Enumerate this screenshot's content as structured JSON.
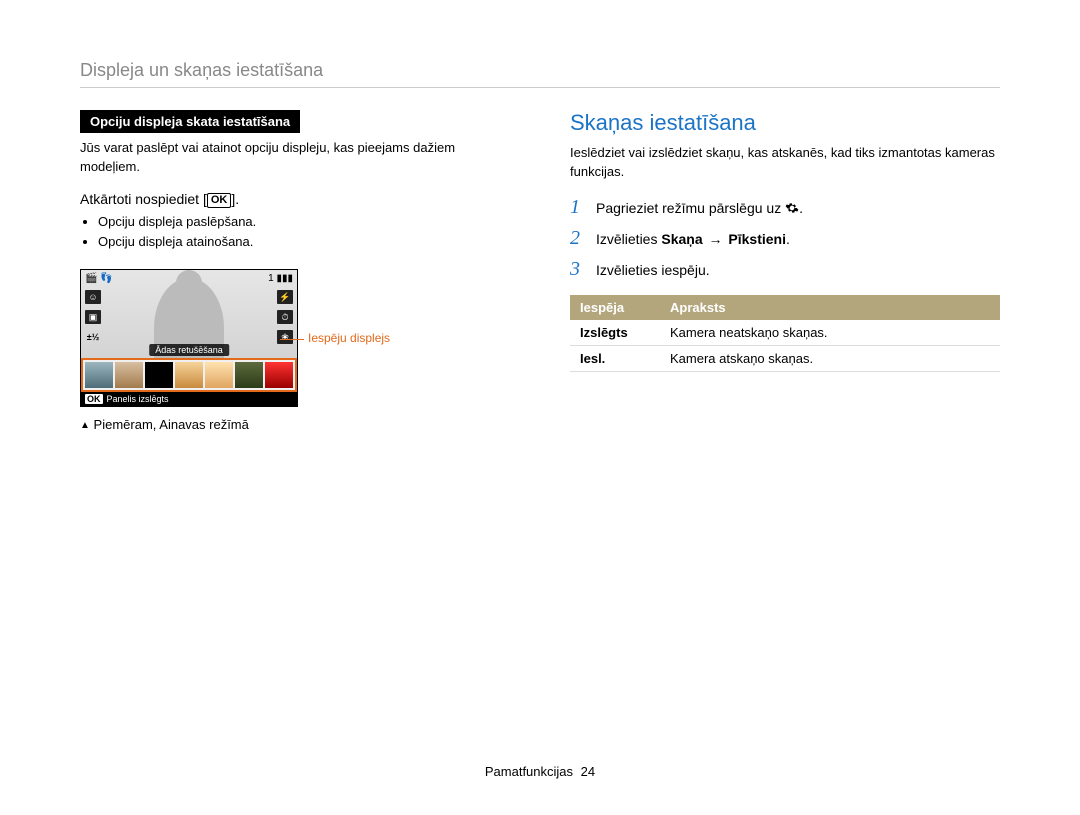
{
  "page_title": "Displeja un skaņas iestatīšana",
  "left": {
    "box_heading": "Opciju displeja skata iestatīšana",
    "intro": "Jūs varat paslēpt vai atainot opciju displeju, kas pieejams dažiem modeļiem.",
    "sub_instruction_prefix": "Atkārtoti nospiediet [",
    "sub_instruction_suffix": "].",
    "ok_label": "OK",
    "bullets": [
      "Opciju displeja paslēpšana.",
      "Opciju displeja atainošana."
    ],
    "camera": {
      "top_bar_left": "🎬 👣",
      "top_bar_right_counter": "1",
      "skin_label": "Ādas retušēšana",
      "panel_text": "Panelis izslēgts",
      "ok": "OK"
    },
    "callout": "Iespēju displejs",
    "example_caption": "Piemēram, Ainavas režīmā"
  },
  "right": {
    "section_head": "Skaņas iestatīšana",
    "intro": "Ieslēdziet vai izslēdziet skaņu, kas atskanēs, kad tiks izmantotas kameras funkcijas.",
    "steps": {
      "s1_prefix": "Pagrieziet režīmu pārslēgu uz ",
      "s1_suffix": ".",
      "s2_prefix": "Izvēlieties ",
      "s2_bold1": "Skaņa",
      "s2_arrow": "→",
      "s2_bold2": "Pīkstieni",
      "s2_suffix": ".",
      "s3": "Izvēlieties iespēju."
    },
    "table": {
      "head_option": "Iespēja",
      "head_desc": "Apraksts",
      "rows": [
        {
          "opt": "Izslēgts",
          "desc": "Kamera neatskaņo skaņas."
        },
        {
          "opt": "Iesl.",
          "desc": "Kamera atskaņo skaņas."
        }
      ]
    }
  },
  "footer": {
    "section": "Pamatfunkcijas",
    "page": "24"
  }
}
